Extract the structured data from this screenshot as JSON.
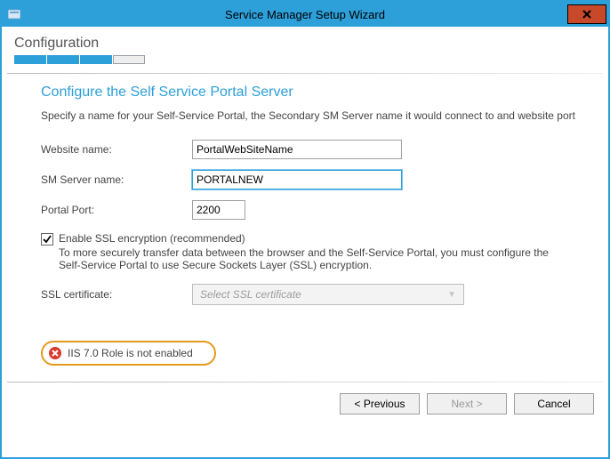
{
  "window": {
    "title": "Service Manager Setup Wizard"
  },
  "stage": {
    "title": "Configuration",
    "progress_current": 3,
    "progress_total": 4
  },
  "page": {
    "title": "Configure the Self Service Portal Server",
    "description": "Specify a name for your Self-Service Portal, the Secondary SM Server name it would connect to and website port"
  },
  "form": {
    "website_label": "Website name:",
    "website_value": "PortalWebSiteName",
    "smserver_label": "SM Server name:",
    "smserver_value": "PORTALNEW",
    "port_label": "Portal Port:",
    "port_value": "2200"
  },
  "ssl": {
    "checkbox_label": "Enable SSL encryption (recommended)",
    "checkbox_checked": true,
    "description": "To more securely transfer data between the browser and the Self-Service Portal, you must configure the Self-Service Portal to use Secure Sockets Layer (SSL) encryption.",
    "cert_label": "SSL certificate:",
    "cert_placeholder": "Select SSL certificate"
  },
  "error": {
    "message": "IIS 7.0 Role is not enabled"
  },
  "footer": {
    "previous": "<  Previous",
    "next": "Next  >",
    "cancel": "Cancel"
  }
}
